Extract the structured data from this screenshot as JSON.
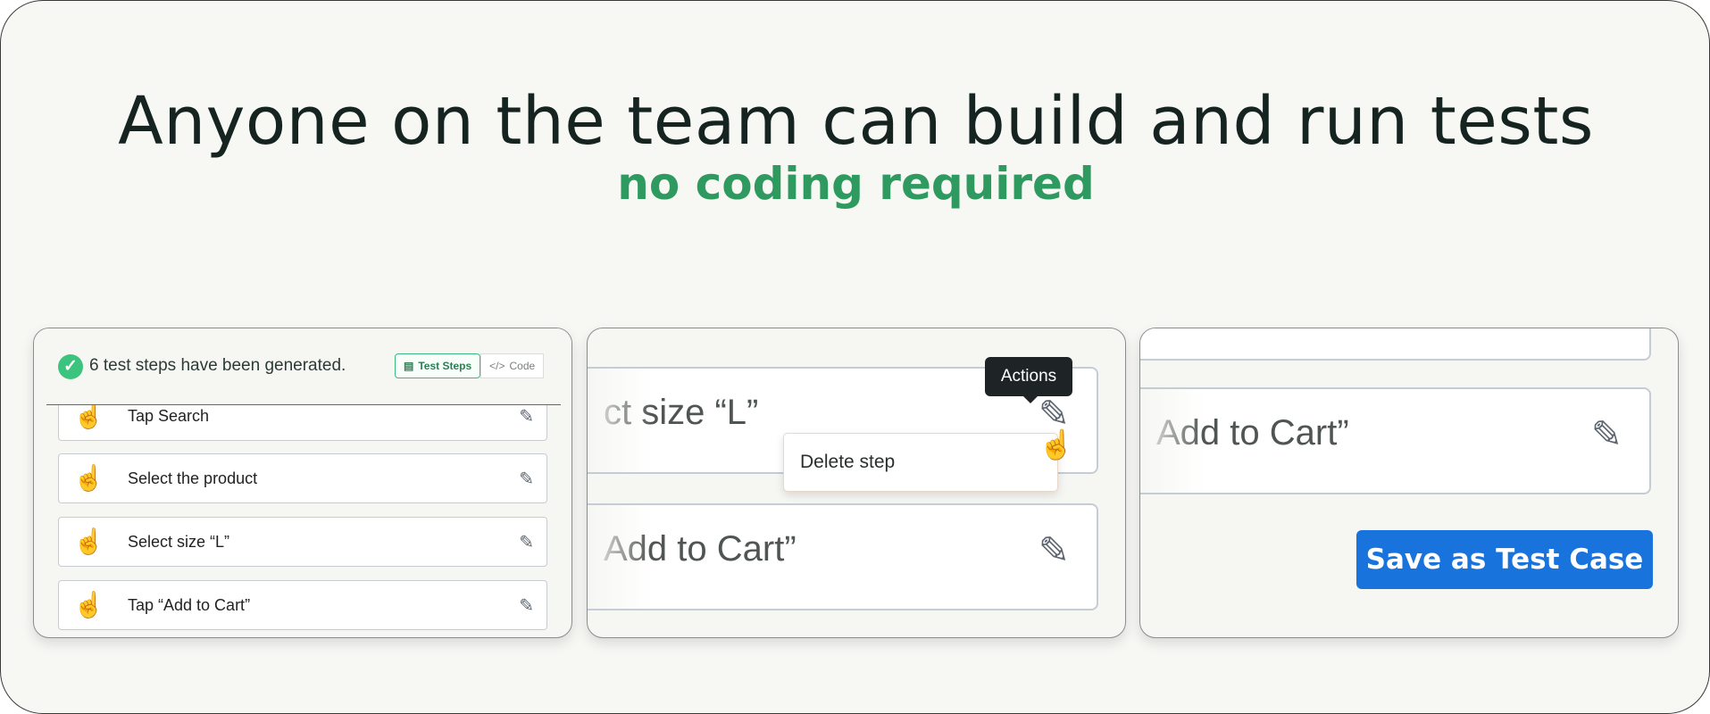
{
  "hero": {
    "title": "Anyone on the team can build and run tests",
    "subtitle": "no coding required"
  },
  "generator_card": {
    "status": "6 test steps have been generated.",
    "tabs": [
      {
        "label": "Test Steps",
        "icon": "document-icon",
        "active": true
      },
      {
        "label": "Code",
        "icon": "code-icon",
        "active": false
      }
    ],
    "steps": [
      {
        "label": "Tap Search",
        "icon": "tap-icon"
      },
      {
        "label": "Select the product",
        "icon": "swipe-icon"
      },
      {
        "label": "Select size “L”",
        "icon": "rotate-gesture-icon"
      },
      {
        "label": "Tap “Add to Cart”",
        "icon": "tap-icon"
      }
    ]
  },
  "editor_card": {
    "item1": "ct size “L”",
    "item2": "Add to Cart”",
    "tooltip": "Actions",
    "menu_item": "Delete step"
  },
  "save_card": {
    "item": "Add to Cart”",
    "button": "Save as Test Case"
  },
  "colors": {
    "accent_green": "#2f9a5f",
    "primary_button": "#1873dc"
  }
}
